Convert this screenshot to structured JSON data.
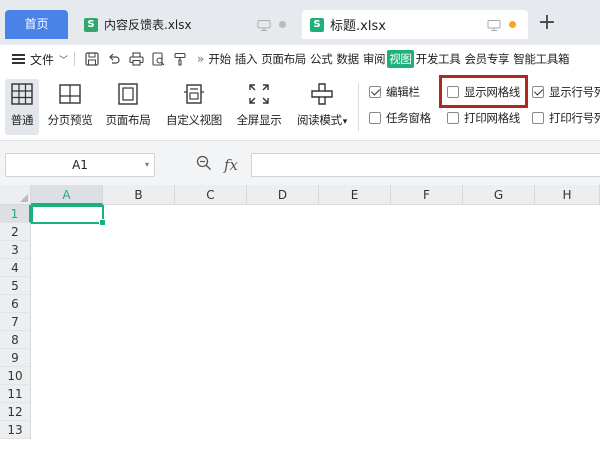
{
  "tabs": {
    "home": "首页",
    "file1": {
      "icon": "S",
      "name": "内容反馈表.xlsx"
    },
    "file2": {
      "icon": "S",
      "name": "标题.xlsx"
    },
    "new_tab": "+"
  },
  "menu": {
    "file_label": "文件",
    "items": [
      "开始",
      "插入",
      "页面布局",
      "公式",
      "数据",
      "审阅",
      "视图",
      "开发工具",
      "会员专享",
      "智能工具箱"
    ],
    "active_item": "视图",
    "more": "»"
  },
  "ribbon": {
    "buttons": [
      {
        "label": "普通",
        "icon": "grid-icon",
        "selected": true
      },
      {
        "label": "分页预览",
        "icon": "page-break-preview-icon"
      },
      {
        "label": "页面布局",
        "icon": "page-layout-icon"
      },
      {
        "label": "自定义视图",
        "icon": "custom-view-icon"
      },
      {
        "label": "全屏显示",
        "icon": "fullscreen-icon"
      },
      {
        "label": "阅读模式",
        "icon": "reading-mode-icon",
        "dropdown": "▾"
      }
    ],
    "checkboxes": [
      {
        "label": "编辑栏",
        "checked": true
      },
      {
        "label": "任务窗格",
        "checked": false
      },
      {
        "label": "显示网格线",
        "checked": false
      },
      {
        "label": "打印网格线",
        "checked": false
      },
      {
        "label": "显示行号列",
        "checked": true
      },
      {
        "label": "打印行号列",
        "checked": false
      }
    ]
  },
  "formula_bar": {
    "name_box": "A1",
    "fx": "fx",
    "value": ""
  },
  "sheet": {
    "columns": [
      "A",
      "B",
      "C",
      "D",
      "E",
      "F",
      "G",
      "H"
    ],
    "rows": [
      "1",
      "2",
      "3",
      "4",
      "5",
      "6",
      "7",
      "8",
      "9",
      "10",
      "11",
      "12",
      "13"
    ],
    "active_column": "A",
    "active_row": "1"
  },
  "colors": {
    "accent": "#1fb07a",
    "home_tab": "#4a83e8",
    "highlight_box": "#b3261e",
    "unsaved_dot": "#f5a623"
  }
}
